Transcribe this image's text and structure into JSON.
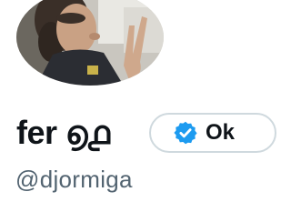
{
  "profile": {
    "display_name": "fer ൭൧",
    "handle": "@djormiga",
    "avatar_alt": "profile photo",
    "verified_pill_label": "Ok",
    "verified_icon": "verified-badge-icon"
  },
  "colors": {
    "name_text": "#0f1419",
    "handle_text": "#536471",
    "verified_blue": "#1d9bf0",
    "pill_border": "#cfd9de"
  }
}
